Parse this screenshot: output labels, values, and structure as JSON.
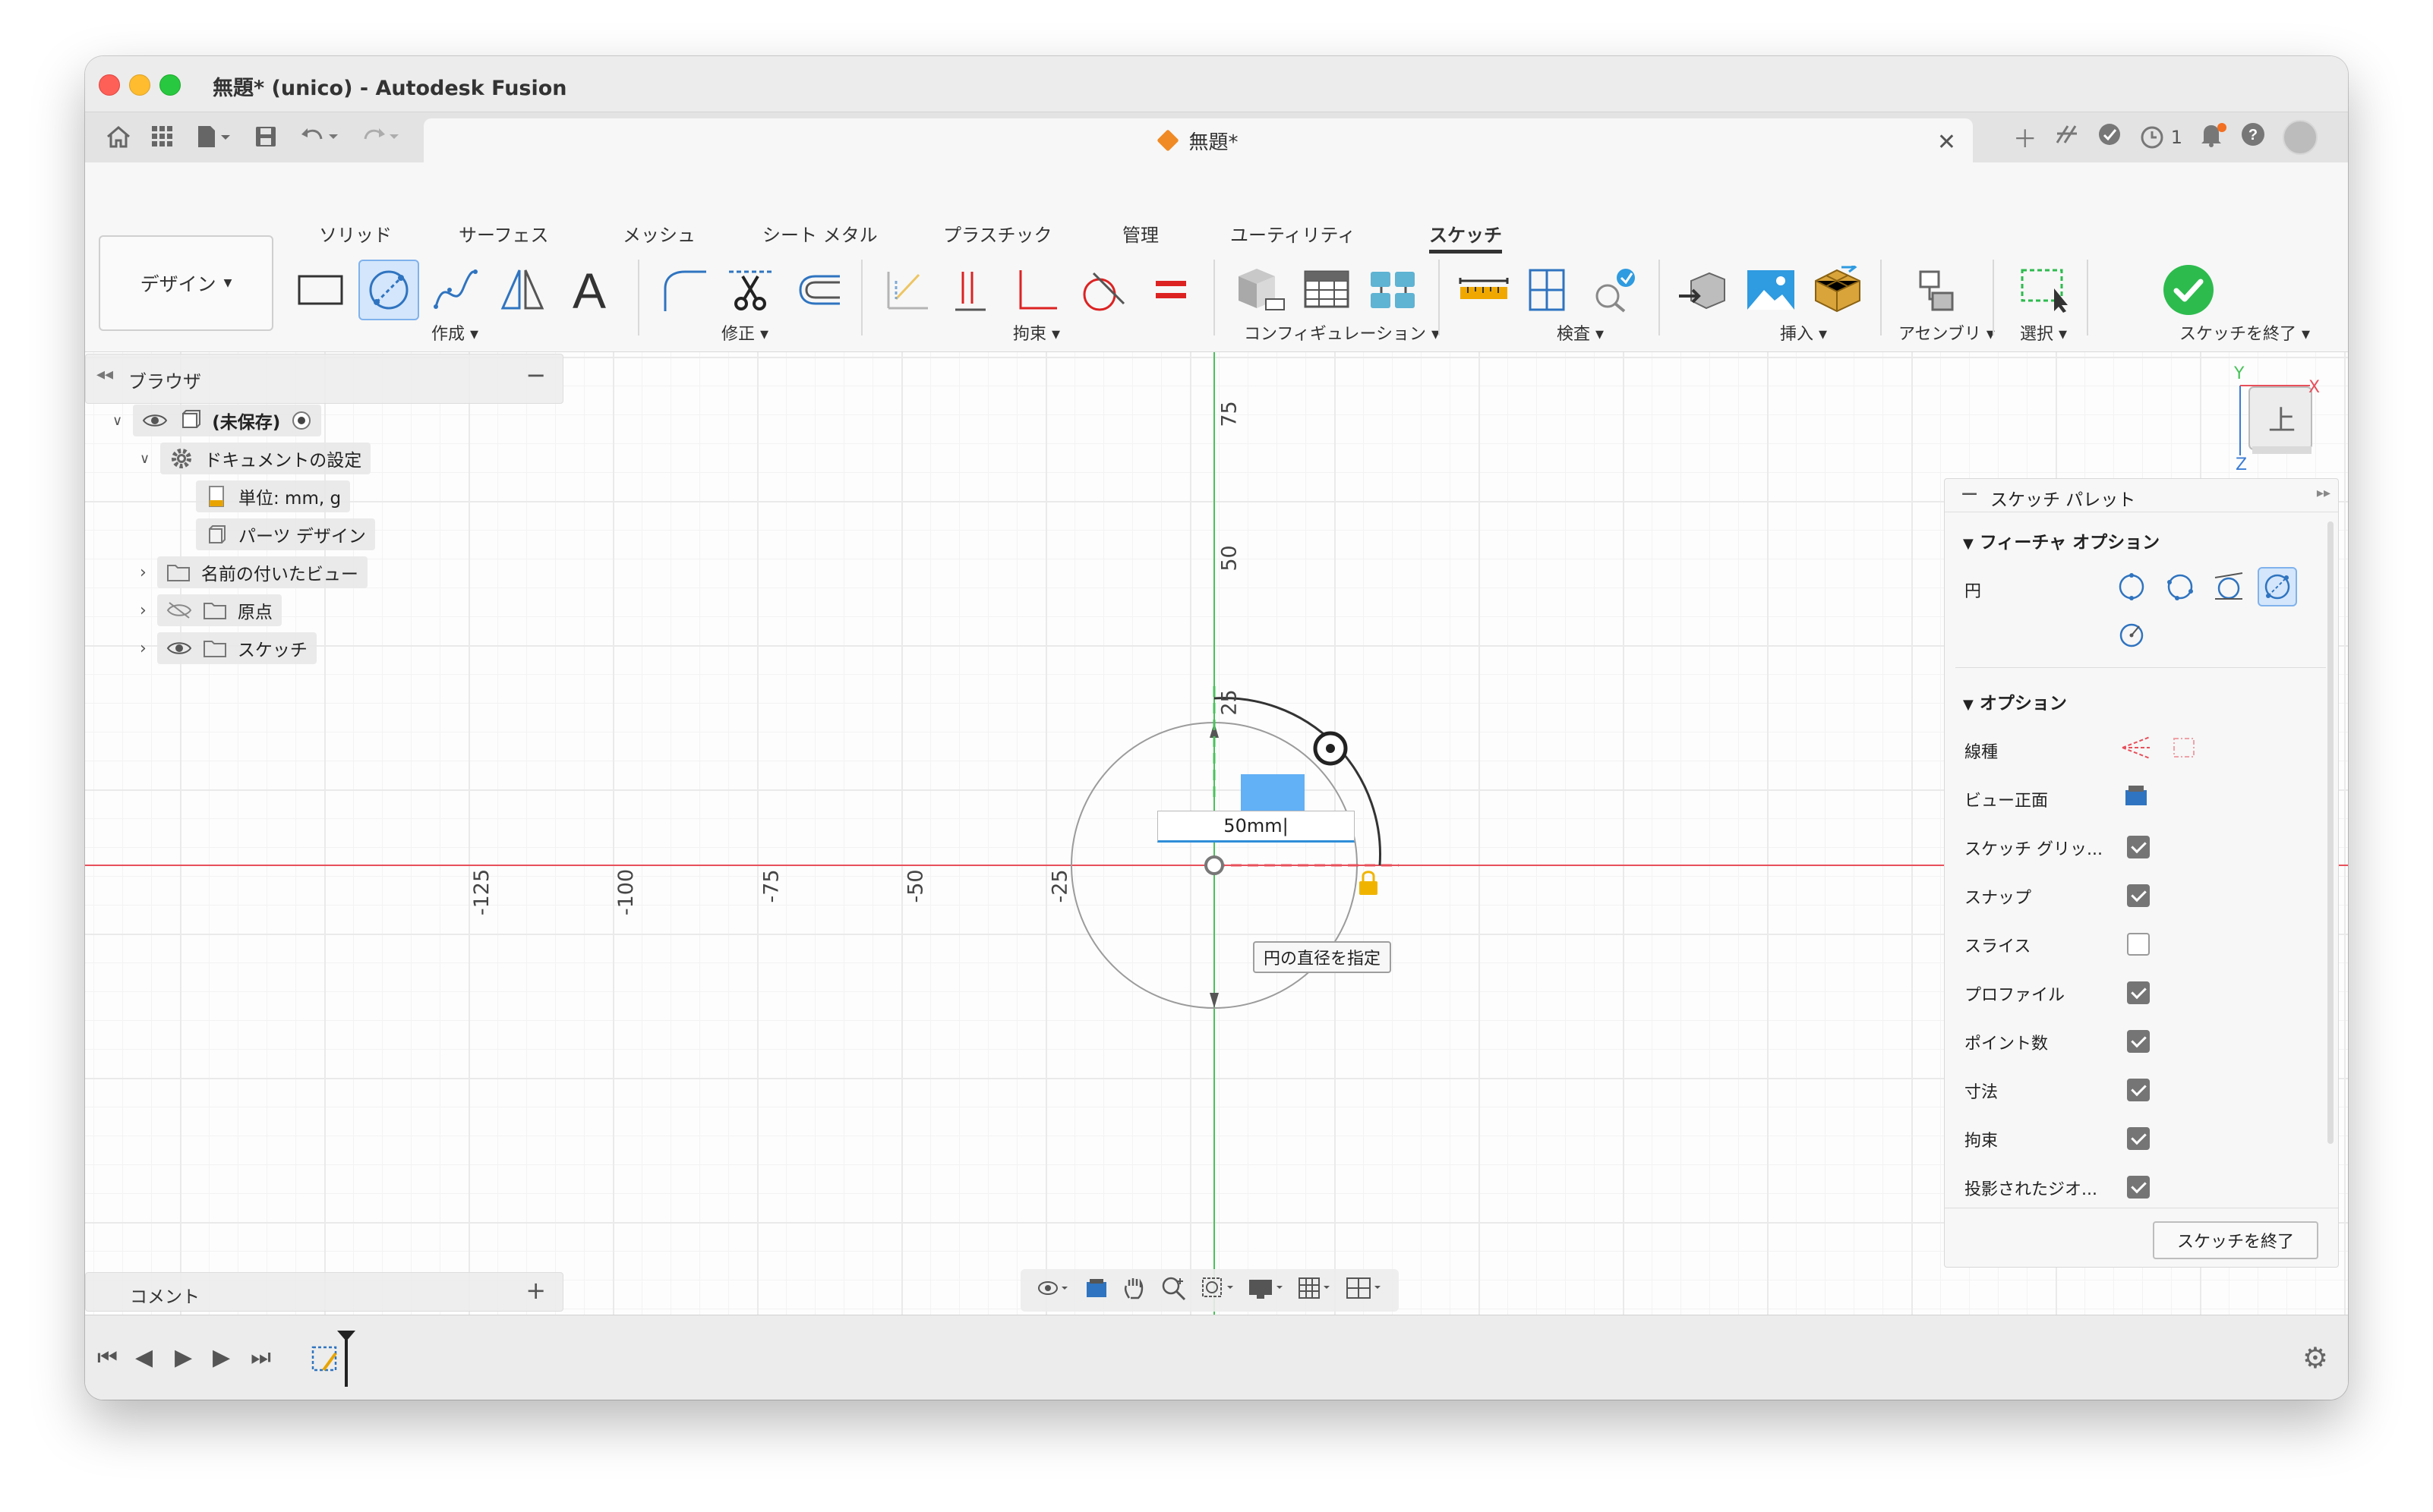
{
  "window": {
    "title": "無題* (unico) - Autodesk Fusion"
  },
  "document_tab": {
    "title": "無題*"
  },
  "header_right": {
    "jobs_count": "1"
  },
  "ribbon": {
    "workspace": "デザイン",
    "tabs": [
      "ソリッド",
      "サーフェス",
      "メッシュ",
      "シート メタル",
      "プラスチック",
      "管理",
      "ユーティリティ",
      "スケッチ"
    ],
    "active_tab": "スケッチ",
    "groups": {
      "create": "作成",
      "modify": "修正",
      "constraints": "拘束",
      "configurations": "コンフィギュレーション",
      "inspect": "検査",
      "insert": "挿入",
      "assemble": "アセンブリ",
      "select": "選択",
      "finish": "スケッチを終了"
    }
  },
  "browser": {
    "title": "ブラウザ",
    "items": {
      "root": "(未保存)",
      "doc_settings": "ドキュメントの設定",
      "units": "単位: mm, g",
      "design_type": "パーツ デザイン",
      "named_views": "名前の付いたビュー",
      "origin": "原点",
      "sketches": "スケッチ"
    }
  },
  "comments": {
    "label": "コメント"
  },
  "canvas": {
    "vertical_axis_labels": [
      "75",
      "50",
      "25"
    ],
    "horizontal_axis_labels": [
      "-125",
      "-100",
      "-75",
      "-50",
      "-25"
    ],
    "dimension_value": "50mm",
    "tooltip": "円の直径を指定"
  },
  "viewcube": {
    "face": "上",
    "x": "X",
    "y": "Y",
    "z": "Z"
  },
  "sketch_palette": {
    "title": "スケッチ パレット",
    "feature_options": {
      "title": "フィーチャ オプション",
      "circle_label": "円"
    },
    "options": {
      "title": "オプション",
      "linetype": "線種",
      "look_at": "ビュー正面",
      "rows": [
        {
          "label": "スケッチ グリッ...",
          "checked": true
        },
        {
          "label": "スナップ",
          "checked": true
        },
        {
          "label": "スライス",
          "checked": false
        },
        {
          "label": "プロファイル",
          "checked": true
        },
        {
          "label": "ポイント数",
          "checked": true
        },
        {
          "label": "寸法",
          "checked": true
        },
        {
          "label": "拘束",
          "checked": true
        },
        {
          "label": "投影されたジオ...",
          "checked": true
        }
      ]
    },
    "finish_button": "スケッチを終了"
  },
  "colors": {
    "accent_blue": "#2f8ed8",
    "finish_green": "#2dbb4e",
    "axis_red": "#e8505b",
    "axis_green": "#49c25a"
  }
}
